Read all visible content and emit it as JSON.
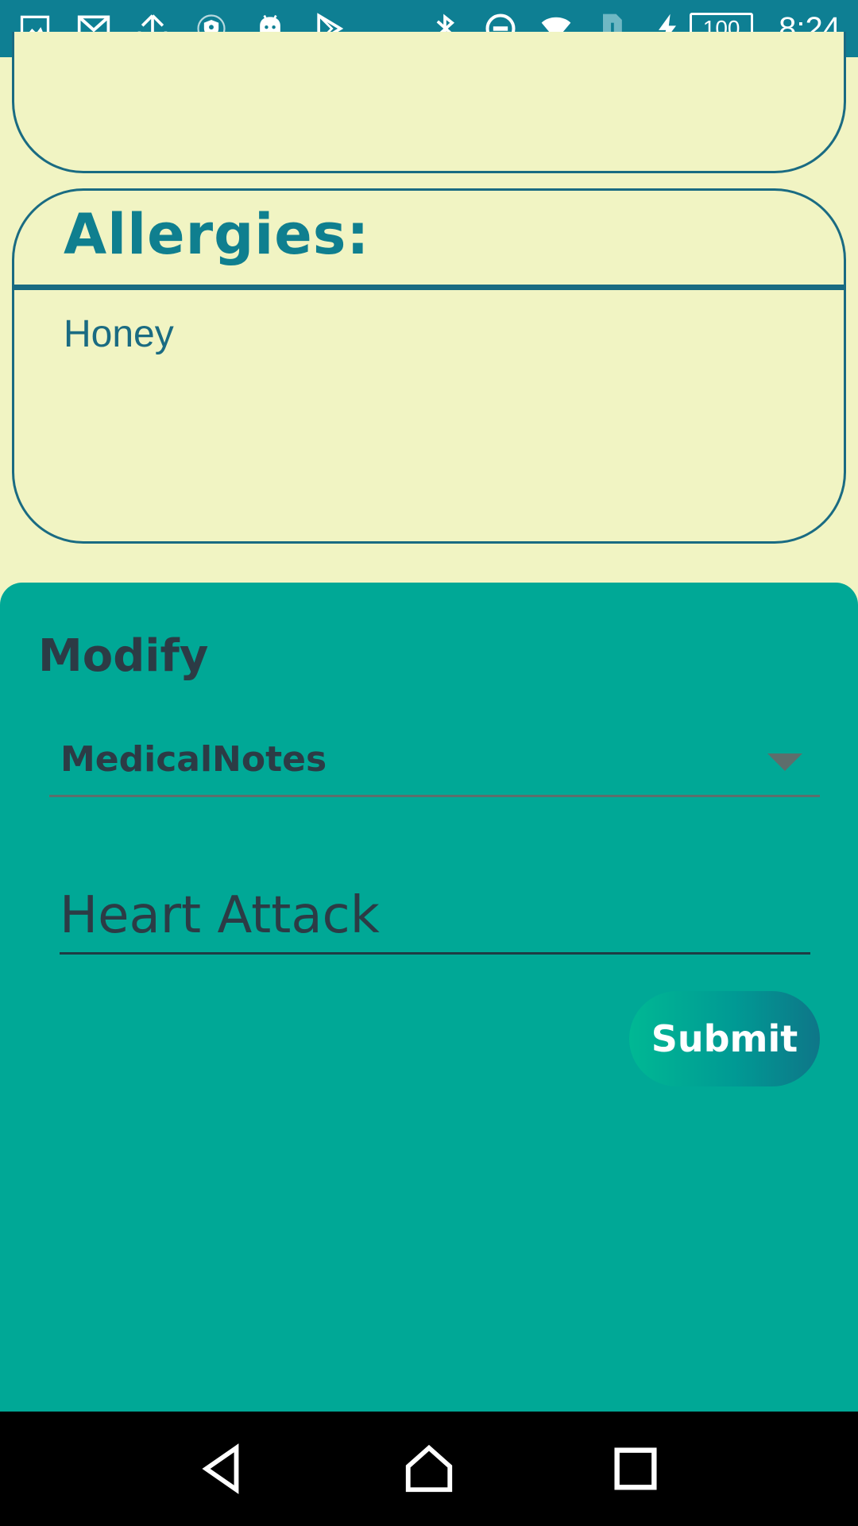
{
  "status_bar": {
    "left_icons": [
      "image-icon",
      "gmail-icon",
      "upload-icon",
      "shield-icon",
      "android-icon",
      "play-store-icon"
    ],
    "right_icons": [
      "bluetooth-icon",
      "dnd-icon",
      "wifi-icon",
      "sim-alert-icon",
      "charging-icon"
    ],
    "battery": "100",
    "time": "8:24"
  },
  "allergies_card": {
    "title": "Allergies:",
    "value": "Honey"
  },
  "modify_panel": {
    "title": "Modify",
    "dropdown_selected": "MedicalNotes",
    "input_value": "Heart Attack",
    "submit_label": "Submit"
  },
  "nav_bar": {
    "buttons": [
      "back-icon",
      "home-icon",
      "recents-icon"
    ]
  },
  "colors": {
    "status_bar": "#0e7f93",
    "page_bg": "#f1f4c3",
    "card_border": "#1a6b82",
    "card_title": "#0f7f8f",
    "panel_bg": "#00a896",
    "panel_text": "#2c3b45"
  }
}
